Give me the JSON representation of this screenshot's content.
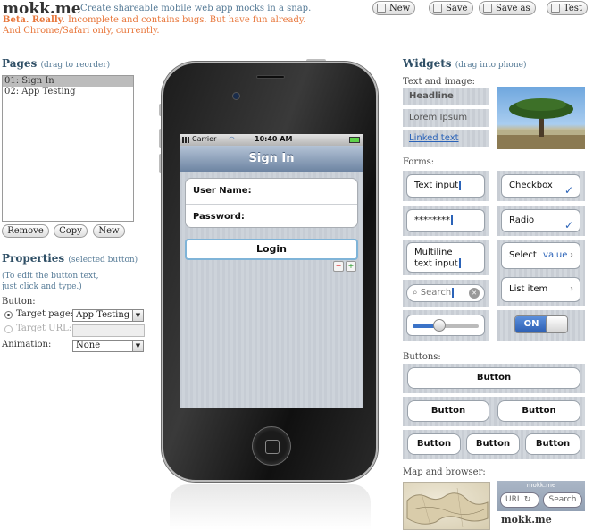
{
  "header": {
    "brand": "mokk.me",
    "tagline": "Create shareable mobile web app mocks in a snap.",
    "beta_bold": "Beta. Really.",
    "beta_rest": " Incomplete and contains bugs. But have fun already.",
    "browser_note": "And Chrome/Safari only, currently."
  },
  "toolbar": {
    "new_label": "New",
    "save_label": "Save",
    "saveas_label": "Save as",
    "test_label": "Test"
  },
  "pages": {
    "title": "Pages",
    "hint": "(drag to reorder)",
    "items": [
      "01: Sign In",
      "02: App Testing"
    ],
    "remove_label": "Remove",
    "copy_label": "Copy",
    "new_label": "New"
  },
  "properties": {
    "title": "Properties",
    "hint": "(selected button)",
    "help_line1": "(To edit the button text,",
    "help_line2": "just click and type.)",
    "button_label": "Button:",
    "target_page_label": "Target page:",
    "target_page_value": "App Testing",
    "target_url_label": "Target URL:",
    "animation_label": "Animation:",
    "animation_value": "None"
  },
  "phone": {
    "carrier": "Carrier",
    "time": "10:40 AM",
    "nav_title": "Sign In",
    "username_label": "User Name:",
    "password_label": "Password:",
    "login_label": "Login"
  },
  "widgets": {
    "title": "Widgets",
    "hint": "(drag into phone)",
    "text_image_label": "Text and image:",
    "headline": "Headline",
    "lorem": "Lorem Ipsum",
    "linked_text": "Linked text",
    "forms_label": "Forms:",
    "text_input": "Text input",
    "checkbox": "Checkbox",
    "password_dots": "********",
    "radio": "Radio",
    "multiline_1": "Multiline",
    "multiline_2": "text input",
    "select": "Select",
    "select_value": "value",
    "search": "Search",
    "list_item": "List item",
    "toggle_on": "ON",
    "buttons_label": "Buttons:",
    "button_text": "Button",
    "map_browser_label": "Map and browser:",
    "browser_title": "mokk.me",
    "browser_url": "URL",
    "browser_search": "Search",
    "browser_brand": "mokk.me"
  },
  "icons": {
    "check": "✓",
    "chevron": "›",
    "reload": "↻",
    "clear": "✕",
    "dropdown": "▼"
  },
  "colors": {
    "accent_orange": "#e8763a",
    "nav_blue": "#6d84a2",
    "link_blue": "#2b63b8",
    "toggle_blue": "#3b73c8",
    "heading": "#2f4f66"
  }
}
